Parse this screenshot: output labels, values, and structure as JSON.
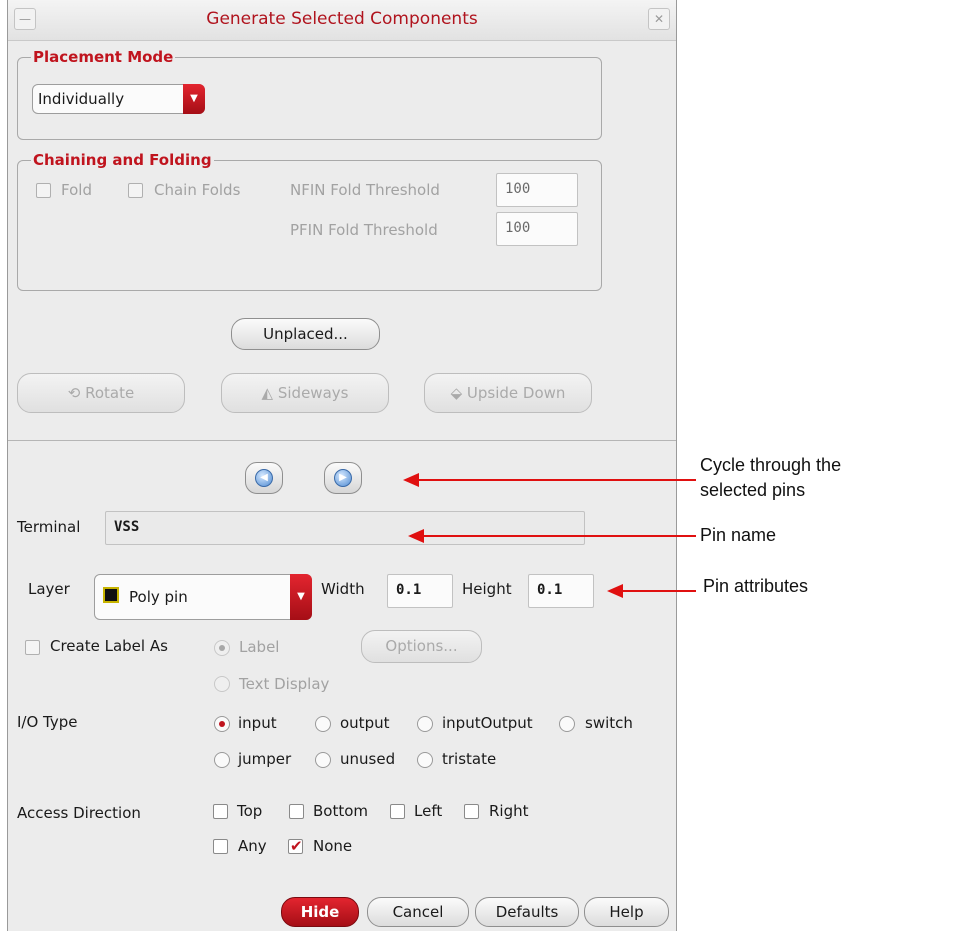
{
  "dialog": {
    "title": "Generate Selected Components",
    "placement_mode": {
      "legend": "Placement Mode",
      "selected": "Individually"
    },
    "chaining": {
      "legend": "Chaining and Folding",
      "fold_label": "Fold",
      "chain_folds_label": "Chain Folds",
      "nfin_label": "NFIN Fold Threshold",
      "nfin_value": "100",
      "pfin_label": "PFIN Fold Threshold",
      "pfin_value": "100"
    },
    "unplaced_button": "Unplaced...",
    "transform_buttons": {
      "rotate": "Rotate",
      "sideways": "Sideways",
      "upside_down": "Upside Down"
    },
    "terminal": {
      "label": "Terminal",
      "value": "VSS"
    },
    "layer": {
      "label": "Layer",
      "selected": "Poly pin",
      "swatch_color": "#111111"
    },
    "width": {
      "label": "Width",
      "value": "0.1"
    },
    "height": {
      "label": "Height",
      "value": "0.1"
    },
    "create_label": {
      "label": "Create Label As",
      "options": [
        "Label",
        "Text Display"
      ],
      "options_button": "Options..."
    },
    "io_type": {
      "label": "I/O Type",
      "options": [
        "input",
        "output",
        "inputOutput",
        "switch",
        "jumper",
        "unused",
        "tristate"
      ],
      "selected": "input"
    },
    "access_direction": {
      "label": "Access Direction",
      "options": [
        "Top",
        "Bottom",
        "Left",
        "Right",
        "Any",
        "None"
      ],
      "checked": [
        "None"
      ]
    },
    "footer": {
      "hide": "Hide",
      "cancel": "Cancel",
      "defaults": "Defaults",
      "help": "Help"
    },
    "accent_color": "#c0141e"
  },
  "annotations": {
    "cycle_line1": "Cycle through the",
    "cycle_line2": "selected pins",
    "pin_name": "Pin name",
    "pin_attributes": "Pin attributes"
  }
}
